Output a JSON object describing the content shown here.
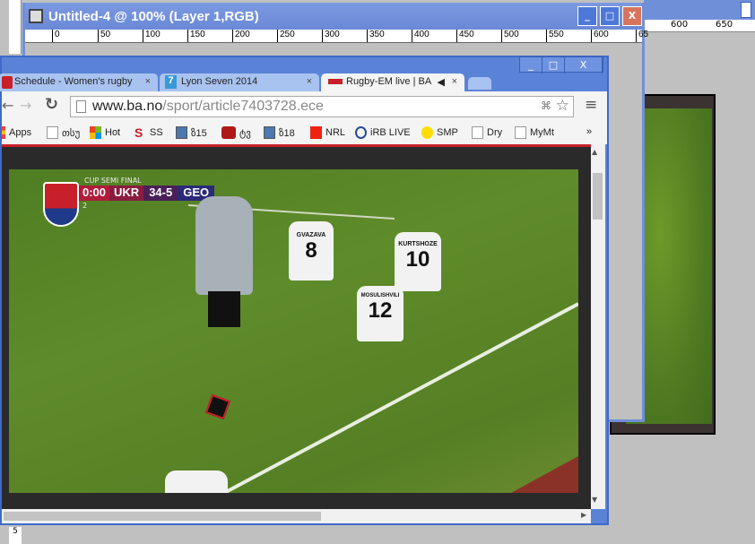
{
  "photoshop": {
    "title": "Untitled-4 @ 100% (Layer 1,RGB)",
    "ruler_ticks": [
      "0",
      "50",
      "100",
      "150",
      "200",
      "250",
      "300",
      "350",
      "400",
      "450",
      "500",
      "550",
      "600",
      "65"
    ],
    "right_ruler_ticks": [
      "600",
      "650"
    ],
    "side_ruler": "5"
  },
  "chrome": {
    "tabs": [
      {
        "label": "Schedule - Women's rugby",
        "close": "×"
      },
      {
        "label": "Lyon Seven 2014",
        "close": "×"
      },
      {
        "label": "Rugby-EM live | BA",
        "close": "×",
        "active": true
      }
    ],
    "url_host": "www.ba.no",
    "url_path": "/sport/article7403728.ece",
    "window_buttons": {
      "minimize": "_",
      "maximize": "□",
      "close": "X"
    },
    "bookmarks": [
      {
        "label": "Apps",
        "icon": "apps-icon"
      },
      {
        "label": "თსუ",
        "icon": "page-icon"
      },
      {
        "label": "Hot",
        "icon": "windows-icon"
      },
      {
        "label": "SS",
        "icon": "supersport-icon"
      },
      {
        "label": "ზ15",
        "icon": "computer-icon"
      },
      {
        "label": "ტვ",
        "icon": "youtube-icon"
      },
      {
        "label": "ზ18",
        "icon": "computer-icon"
      },
      {
        "label": "NRL",
        "icon": "nrl-icon"
      },
      {
        "label": "iRB LIVE",
        "icon": "irb-icon"
      },
      {
        "label": "SMP",
        "icon": "smp-icon"
      },
      {
        "label": "Dry",
        "icon": "page-icon"
      },
      {
        "label": "MyMt",
        "icon": "page-icon"
      }
    ],
    "more_bookmarks": "»"
  },
  "video": {
    "competition": "CUP SEMI FINAL",
    "clock": "0:00",
    "period": "2",
    "team_home": "UKR",
    "score": "34-5",
    "team_away": "GEO",
    "players": [
      {
        "name": "GVAZAVA",
        "number": "8"
      },
      {
        "name": "KURTSHOZE",
        "number": "10"
      },
      {
        "name": "MOSULISHVILI",
        "number": "12"
      }
    ]
  },
  "colors": {
    "xp_blue": "#6f8fd8",
    "chrome_blue": "#5a83d8",
    "accent_red": "#c8202a"
  }
}
